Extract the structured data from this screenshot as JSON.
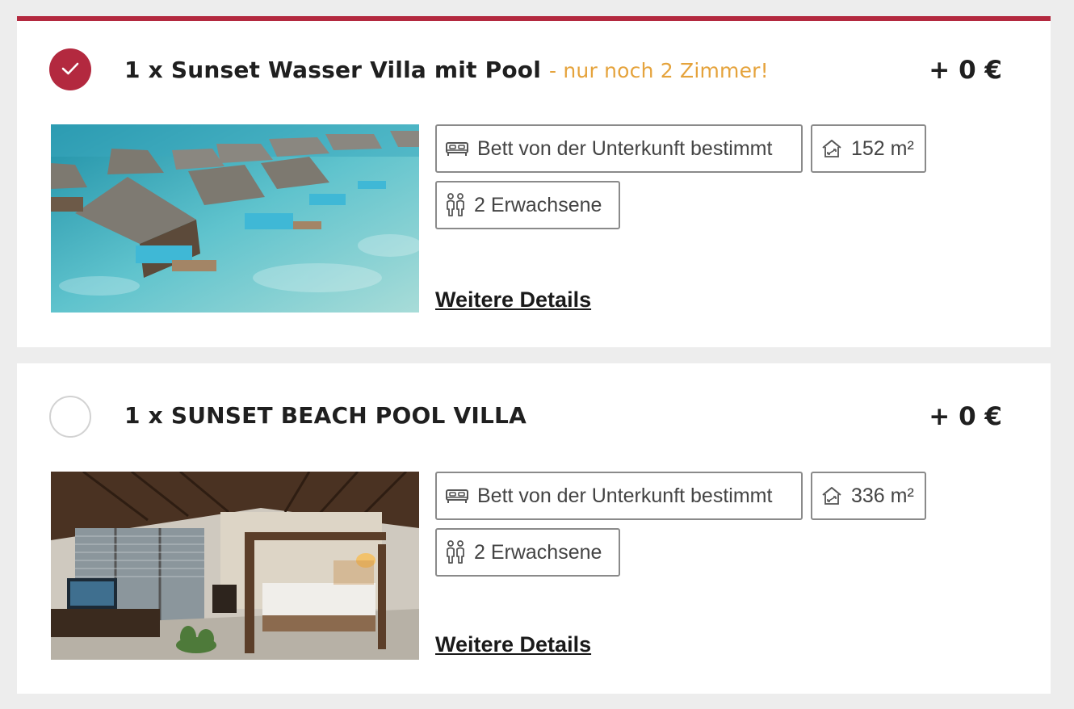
{
  "rooms": [
    {
      "title": "1 x Sunset Wasser Villa mit Pool",
      "availability": "- nur noch 2 Zimmer!",
      "price": "+ 0 €",
      "selected": true,
      "bed": "Bett von der Unterkunft bestimmt",
      "size": "152 m²",
      "guests": "2 Erwachsene",
      "details_link": "Weitere Details",
      "image": "overwater-villas-photo"
    },
    {
      "title": "1 x SUNSET BEACH POOL VILLA",
      "availability": "",
      "price": "+ 0 €",
      "selected": false,
      "bed": "Bett von der Unterkunft bestimmt",
      "size": "336 m²",
      "guests": "2 Erwachsene",
      "details_link": "Weitere Details",
      "image": "villa-bedroom-photo"
    }
  ],
  "icons": {
    "bed": "bed-icon",
    "size": "house-area-icon",
    "guests": "two-persons-icon",
    "check": "checkmark-icon"
  },
  "colors": {
    "accent": "#b3293f",
    "availability": "#e5a33c",
    "background": "#ededed"
  }
}
